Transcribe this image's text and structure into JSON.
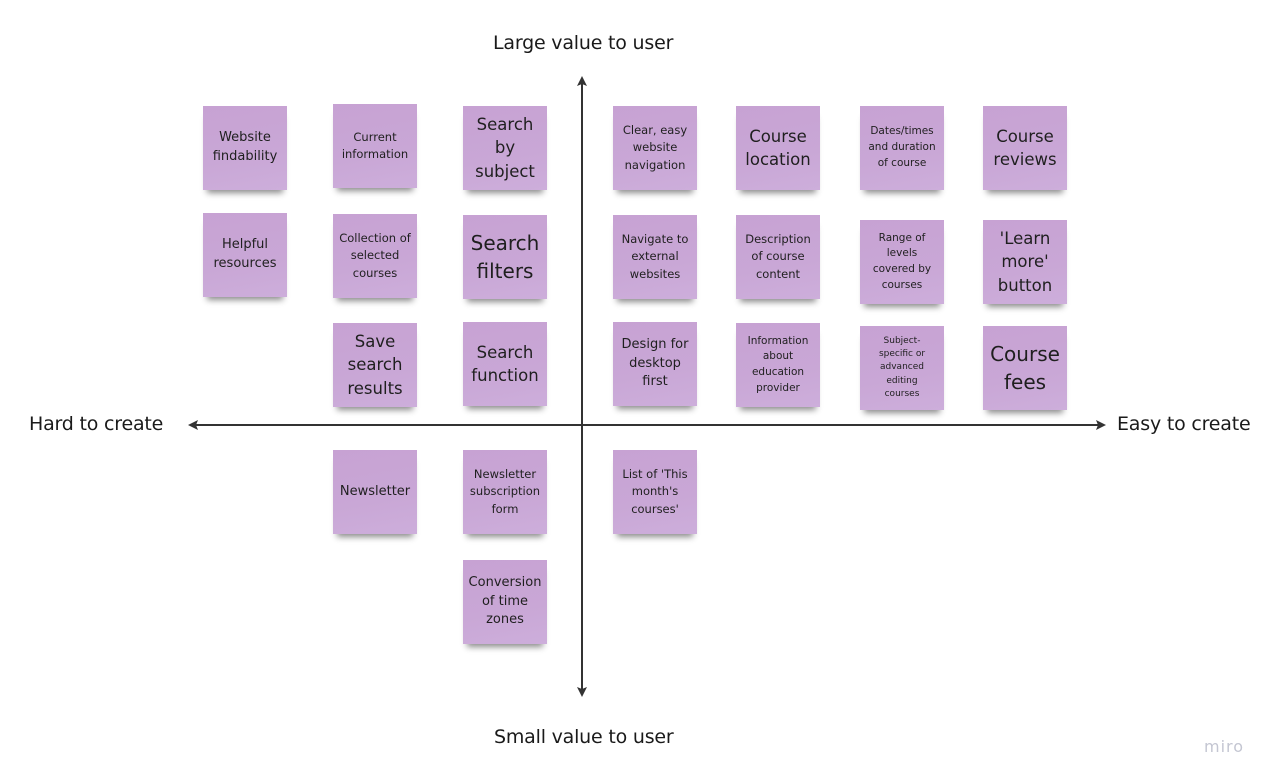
{
  "board": {
    "axes": {
      "top_label": "Large value to user",
      "bottom_label": "Small value to user",
      "left_label": "Hard to create",
      "right_label": "Easy to create",
      "line_color": "#333333"
    },
    "sticky_color": "#c8a6d6",
    "stickies": [
      {
        "text": "Website findability"
      },
      {
        "text": "Helpful resources"
      },
      {
        "text": "Current information"
      },
      {
        "text": "Collection of selected courses"
      },
      {
        "text": "Save search results"
      },
      {
        "text": "Newsletter"
      },
      {
        "text": "Search by subject"
      },
      {
        "text": "Search filters"
      },
      {
        "text": "Search function"
      },
      {
        "text": "Newsletter subscription form"
      },
      {
        "text": "Conversion of time zones"
      },
      {
        "text": "Clear, easy website navigation"
      },
      {
        "text": "Navigate to external websites"
      },
      {
        "text": "Design for desktop first"
      },
      {
        "text": "List of 'This month's courses'"
      },
      {
        "text": "Course location"
      },
      {
        "text": "Description of course content"
      },
      {
        "text": "Information about education provider"
      },
      {
        "text": "Dates/times and duration of course"
      },
      {
        "text": "Range of levels covered by courses"
      },
      {
        "text": "Subject-specific or advanced editing courses"
      },
      {
        "text": "Course reviews"
      },
      {
        "text": "'Learn more' button"
      },
      {
        "text": "Course fees"
      }
    ]
  },
  "branding": {
    "logo_text": "miro"
  }
}
